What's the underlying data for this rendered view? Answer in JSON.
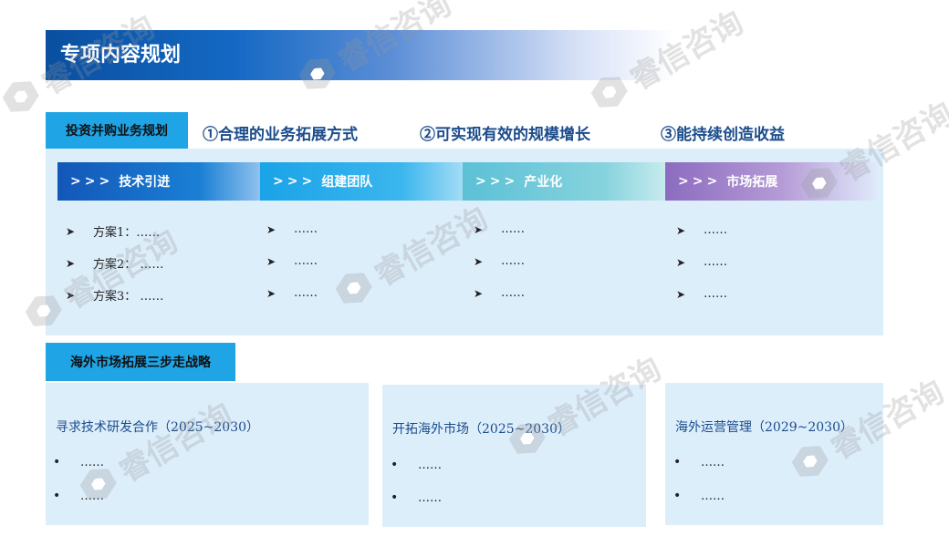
{
  "title": "专项内容规划",
  "section1": {
    "label": "投资并购业务规划",
    "goals": [
      "①合理的业务拓展方式",
      "②可实现有效的规模增长",
      "③能持续创造收益"
    ],
    "steps": [
      {
        "arrows": ">>>",
        "label": "技术引进",
        "items": [
          "方案1：……",
          "方案2： ……",
          "方案3： ……"
        ]
      },
      {
        "arrows": ">>>",
        "label": "组建团队",
        "items": [
          "……",
          "……",
          "……"
        ]
      },
      {
        "arrows": ">>>",
        "label": "产业化",
        "items": [
          "……",
          "……",
          "……"
        ]
      },
      {
        "arrows": ">>>",
        "label": "市场拓展",
        "items": [
          "……",
          "……",
          "……"
        ]
      }
    ]
  },
  "section2": {
    "label": "海外市场拓展三步走战略",
    "cards": [
      {
        "title": "寻求技术研发合作（2025~2030）",
        "items": [
          "……",
          "……"
        ]
      },
      {
        "title": "开拓海外市场（2025~2030）",
        "items": [
          "……",
          "……"
        ]
      },
      {
        "title": "海外运营管理（2029~2030）",
        "items": [
          "……",
          "……"
        ]
      }
    ]
  },
  "watermark": "睿信咨询",
  "colors": {
    "title_start": "#0a4fa0",
    "label_bg": "#1fa4e6",
    "panel_bg": "#ddeefb",
    "goal_text": "#1b4c8c",
    "step1": "#1565c0",
    "step2": "#1aa3e8",
    "step3": "#6cc7d2",
    "step4": "#9a78c4"
  }
}
